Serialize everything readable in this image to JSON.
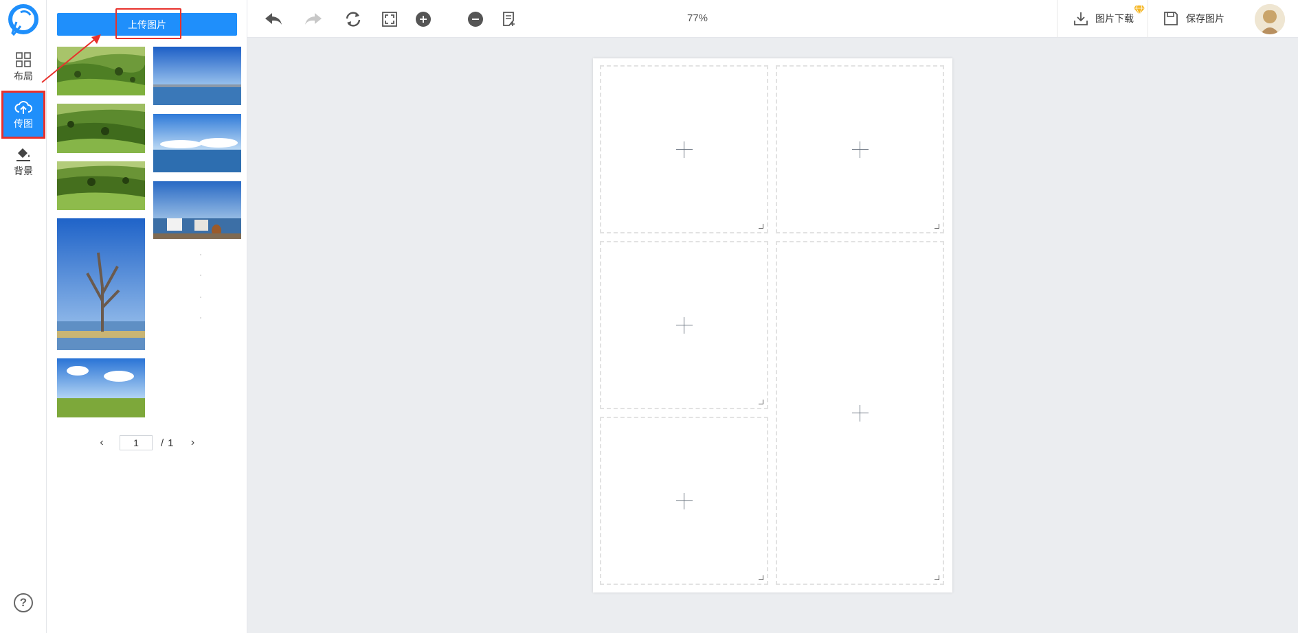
{
  "rail": {
    "items": [
      {
        "label": "布局",
        "icon": "grid-layout-icon"
      },
      {
        "label": "传图",
        "icon": "cloud-upload-icon"
      },
      {
        "label": "背景",
        "icon": "paint-bucket-icon"
      }
    ],
    "help_label": "?"
  },
  "panel": {
    "upload_label": "上传图片",
    "thumbnails": [
      {
        "name": "green-hills-1"
      },
      {
        "name": "lake-sky-1"
      },
      {
        "name": "green-hills-2"
      },
      {
        "name": "lake-clouds"
      },
      {
        "name": "green-hills-3"
      },
      {
        "name": "lakeside-chairs"
      },
      {
        "name": "bare-tree-lake"
      },
      {
        "name": "grass-sky-clouds"
      }
    ],
    "pagination": {
      "prev": "‹",
      "current": "1",
      "separator": "/",
      "total": "1",
      "next": "›"
    }
  },
  "toolbar": {
    "zoom_level": "77%",
    "download_label": "图片下载",
    "save_label": "保存图片",
    "vip_color": "#f5b623"
  },
  "colors": {
    "accent": "#1f8ffb",
    "annotation": "#e8312c",
    "workspace": "#ebedf0"
  },
  "canvas": {
    "cells": [
      {
        "id": 1,
        "icon": "plus-icon"
      },
      {
        "id": 2,
        "icon": "plus-icon"
      },
      {
        "id": 3,
        "icon": "plus-icon"
      },
      {
        "id": 4,
        "icon": "plus-icon"
      },
      {
        "id": 5,
        "icon": "plus-icon"
      }
    ]
  }
}
